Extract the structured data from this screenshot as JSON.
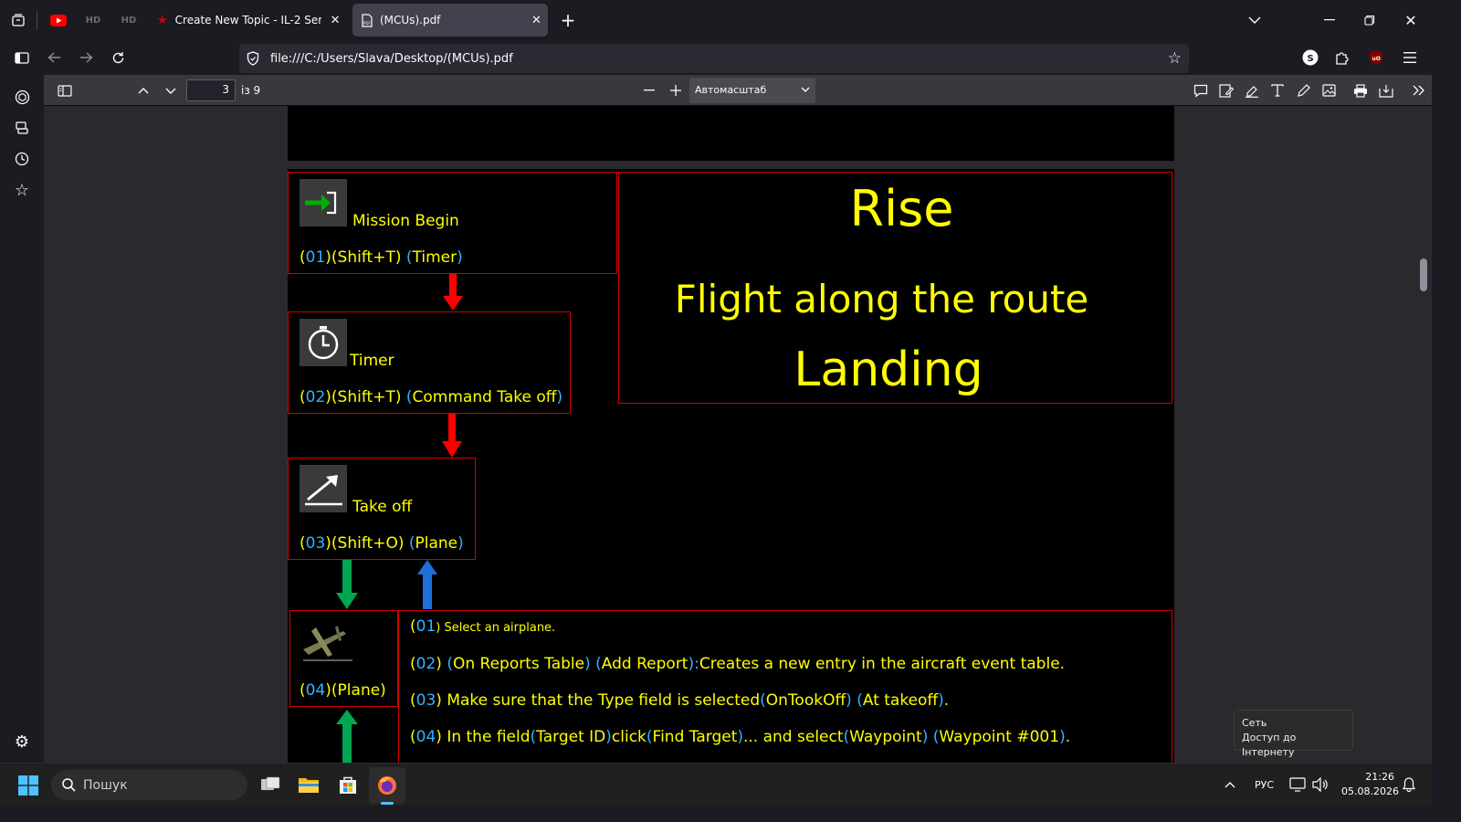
{
  "tabs": [
    {
      "label": "Create New Topic - IL-2 Series F",
      "active": false
    },
    {
      "label": "(MCUs).pdf",
      "active": true
    }
  ],
  "pinned_tabs": [
    {
      "icon": "youtube-icon"
    },
    {
      "label": "HD"
    },
    {
      "label": "HD"
    }
  ],
  "address": {
    "url": "file:///C:/Users/Slava/Desktop/(MCUs).pdf"
  },
  "pdf_toolbar": {
    "page_number": "3",
    "page_count": "із 9",
    "zoom": "Автомасштаб"
  },
  "document": {
    "mission_begin": {
      "title": "Mission Begin",
      "p1": "(",
      "num": "01",
      "p2": ")",
      "key": "(Shift+T)",
      "sp": " ",
      "p3": "(",
      "target": "Timer",
      "p4": ")"
    },
    "timer": {
      "title": "Timer",
      "p1": "(",
      "num": "02",
      "p2": ")",
      "key": "(Shift+T)",
      "sp": " ",
      "p3": "(",
      "target": "Command Take off",
      "p4": ")"
    },
    "takeoff": {
      "title": "Take off",
      "p1": "(",
      "num": "03",
      "p2": ")",
      "key": "(Shift+O)",
      "sp": " ",
      "p3": "(",
      "target": "Plane",
      "p4": ")"
    },
    "plane": {
      "p1": "(",
      "num": "04",
      "p2": ")",
      "target": "(Plane)"
    },
    "summary": {
      "line1": "Rise",
      "line2": "Flight along the route",
      "line3": "Landing"
    },
    "steps": [
      {
        "a": "(",
        "num": "01",
        "b": ")",
        "c": " Select an airplane."
      },
      {
        "a": "(",
        "num": "02",
        "b": ")",
        "c": " ",
        "d": "(",
        "e": "On Reports Table",
        "f": ")",
        "g": " ",
        "h": "(",
        "i": "Add Report",
        "j": ")",
        "k": ":",
        "l": "Creates a new entry in the aircraft event table."
      },
      {
        "a": "(",
        "num": "03",
        "b": ")",
        "c": " Make sure that the Type field is selected",
        "d": "(",
        "e": "OnTookOff",
        "f": ")",
        "g": " ",
        "h": "(",
        "i": "At takeoff",
        "j": ")",
        "k": "."
      },
      {
        "a": "(",
        "num": "04",
        "b": ")",
        "c": " In the field",
        "d": "(",
        "e": "Target ID",
        "f": ")",
        "g": "click",
        "h": "(",
        "i": "Find Target",
        "j": ")",
        "k": "... and select",
        "l": "(",
        "m": "Waypoint",
        "n": ")",
        "o": " ",
        "p": "(",
        "q": "Waypoint #001",
        "r": ")",
        "s": "."
      }
    ]
  },
  "tooltip": {
    "title": "Сеть",
    "text": "Доступ до Інтернету"
  },
  "taskbar": {
    "search_placeholder": "Пошук",
    "language": "РУС",
    "time": "21:26",
    "date": "05.08.2026"
  },
  "colors": {
    "highlight_yellow": "#ffff00",
    "highlight_blue": "#2fb3ff",
    "box_border_red": "#d40000",
    "arrow_green": "#00a651",
    "arrow_blue": "#1e6fd9"
  }
}
